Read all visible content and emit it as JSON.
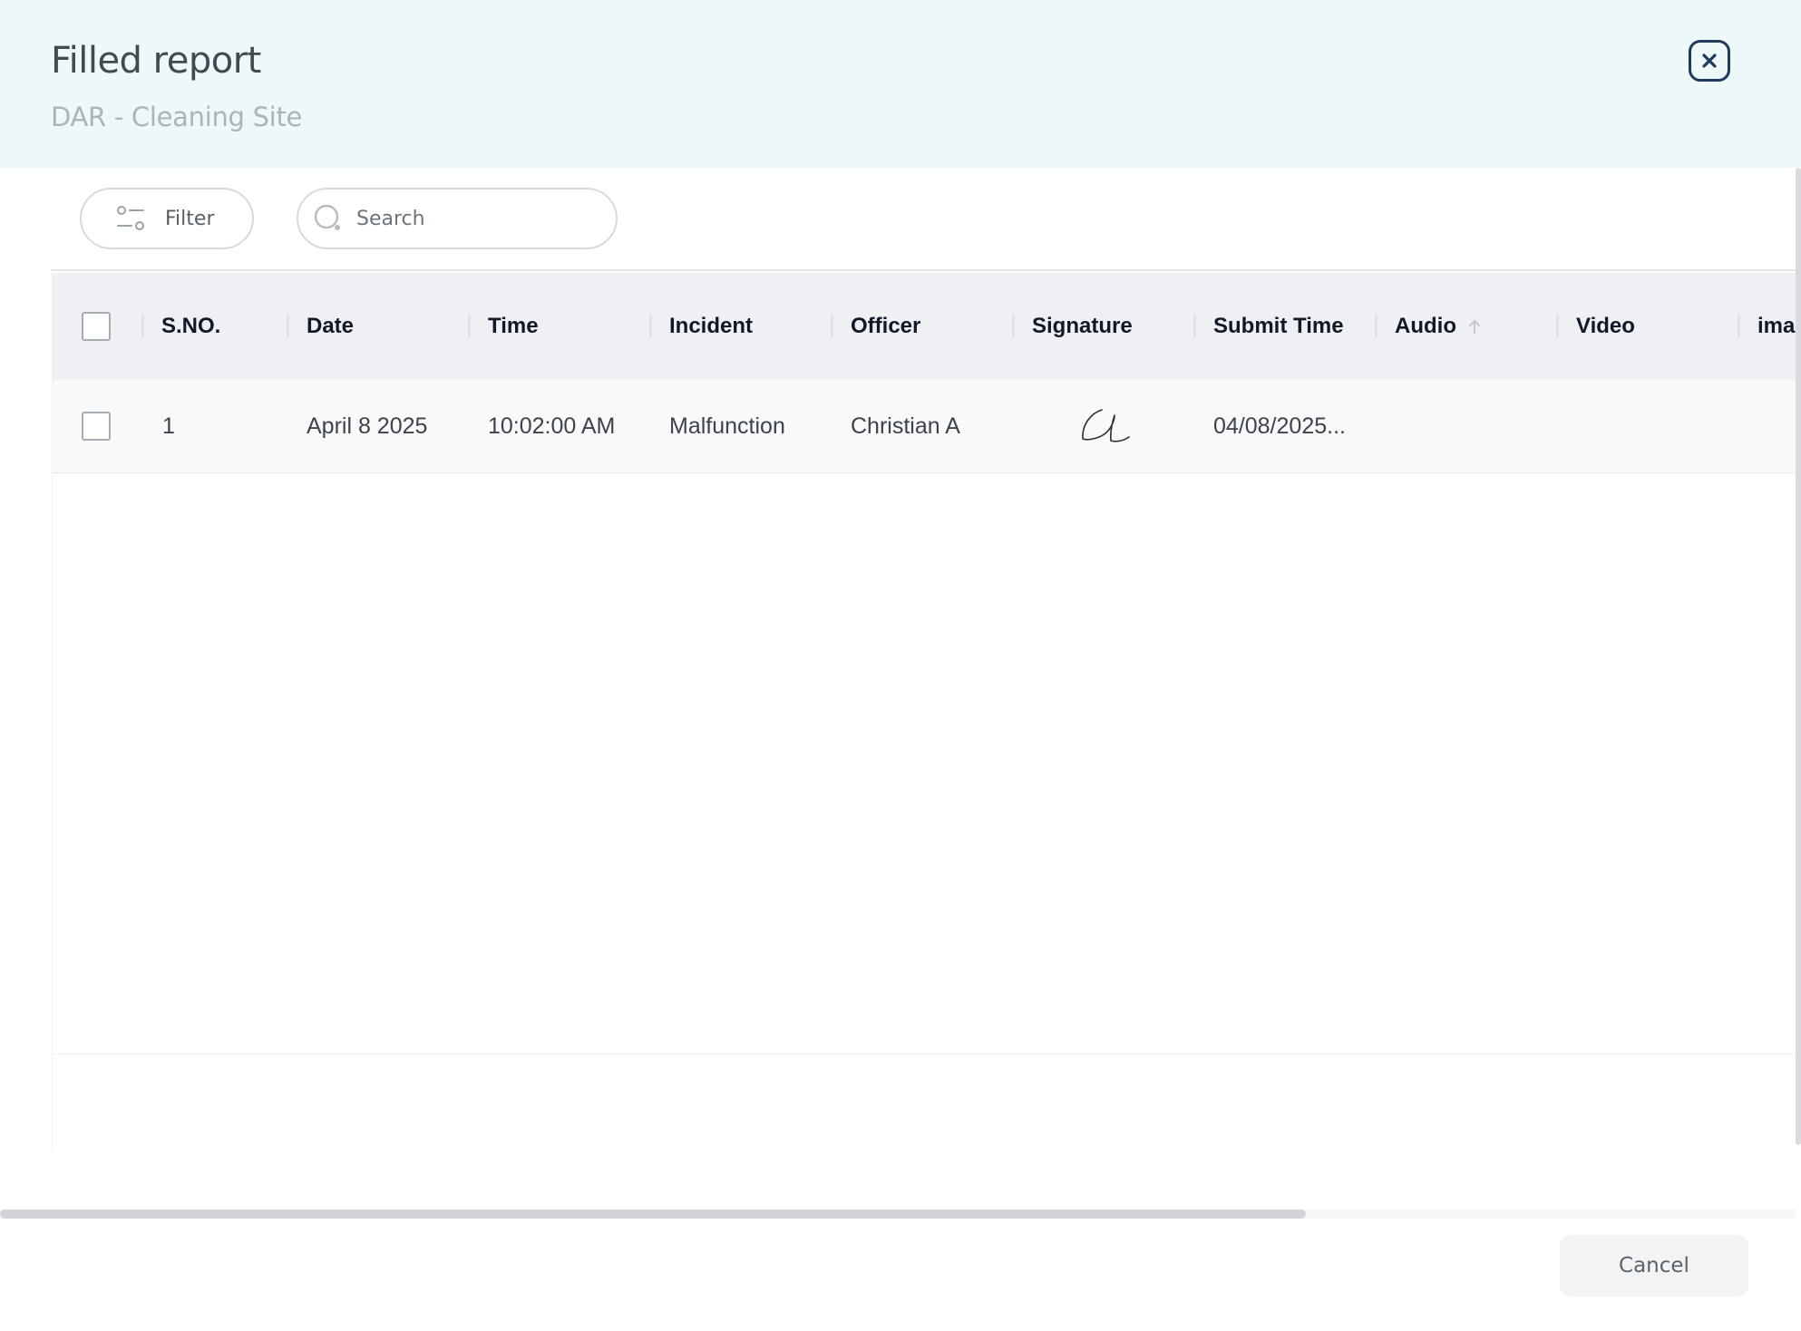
{
  "header": {
    "title": "Filled report",
    "subtitle": "DAR - Cleaning Site"
  },
  "toolbar": {
    "filter_label": "Filter",
    "search_placeholder": "Search",
    "search_value": ""
  },
  "table": {
    "columns": [
      "S.NO.",
      "Date",
      "Time",
      "Incident",
      "Officer",
      "Signature",
      "Submit Time",
      "Audio",
      "Video",
      "ima"
    ],
    "sorted_column": "Audio",
    "sort_direction": "ascending",
    "rows": [
      {
        "sno": "1",
        "date": "April 8 2025",
        "time": "10:02:00 AM",
        "incident": "Malfunction",
        "officer": "Christian A",
        "signature": "signature-image",
        "submit_time": "04/08/2025...",
        "audio": "",
        "video": "",
        "ima": ""
      }
    ]
  },
  "footer": {
    "cancel_label": "Cancel"
  },
  "icons": {
    "close": "close-icon",
    "filter": "filter-sliders-icon",
    "search": "search-icon",
    "sort": "arrow-up-icon"
  },
  "colors": {
    "header_bg": "#eef8f8",
    "close_border": "#1e3a5f",
    "table_header_bg": "#eef0f4"
  }
}
